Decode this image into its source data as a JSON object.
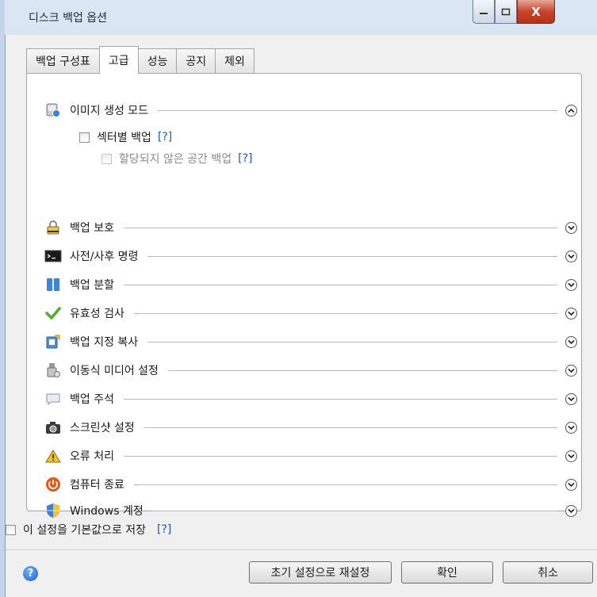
{
  "window": {
    "title": "디스크 백업 옵션",
    "close_glyph": "X"
  },
  "tabs": [
    {
      "label": "백업 구성표",
      "active": false
    },
    {
      "label": "고급",
      "active": true
    },
    {
      "label": "성능",
      "active": false
    },
    {
      "label": "공지",
      "active": false
    },
    {
      "label": "제외",
      "active": false
    }
  ],
  "sections": [
    {
      "label": "이미지 생성 모드",
      "icon": "disk-image-icon",
      "expanded": true
    },
    {
      "label": "백업 보호",
      "icon": "lock-icon",
      "expanded": false
    },
    {
      "label": "사전/사후 명령",
      "icon": "terminal-icon",
      "expanded": false
    },
    {
      "label": "백업 분할",
      "icon": "split-icon",
      "expanded": false
    },
    {
      "label": "유효성 검사",
      "icon": "checkmark-icon",
      "expanded": false
    },
    {
      "label": "백업 지정 복사",
      "icon": "copy-icon",
      "expanded": false
    },
    {
      "label": "이동식 미디어 설정",
      "icon": "usb-media-icon",
      "expanded": false
    },
    {
      "label": "백업 주석",
      "icon": "comment-icon",
      "expanded": false
    },
    {
      "label": "스크린샷 설정",
      "icon": "camera-icon",
      "expanded": false
    },
    {
      "label": "오류 처리",
      "icon": "warning-icon",
      "expanded": false
    },
    {
      "label": "컴퓨터 종료",
      "icon": "power-icon",
      "expanded": false
    },
    {
      "label": "Windows 계정",
      "icon": "shield-icon",
      "expanded": false
    }
  ],
  "image_mode": {
    "sector_backup_label": "섹터별 백업",
    "sector_backup_help": "[?]",
    "unallocated_label": "할당되지 않은 공간 백업",
    "unallocated_help": "[?]"
  },
  "save_default": {
    "label": "이 설정을 기본값으로 저장",
    "help": "[?]"
  },
  "footer": {
    "help_glyph": "?",
    "reset_label": "초기 설정으로 재설정",
    "ok_label": "확인",
    "cancel_label": "취소"
  }
}
